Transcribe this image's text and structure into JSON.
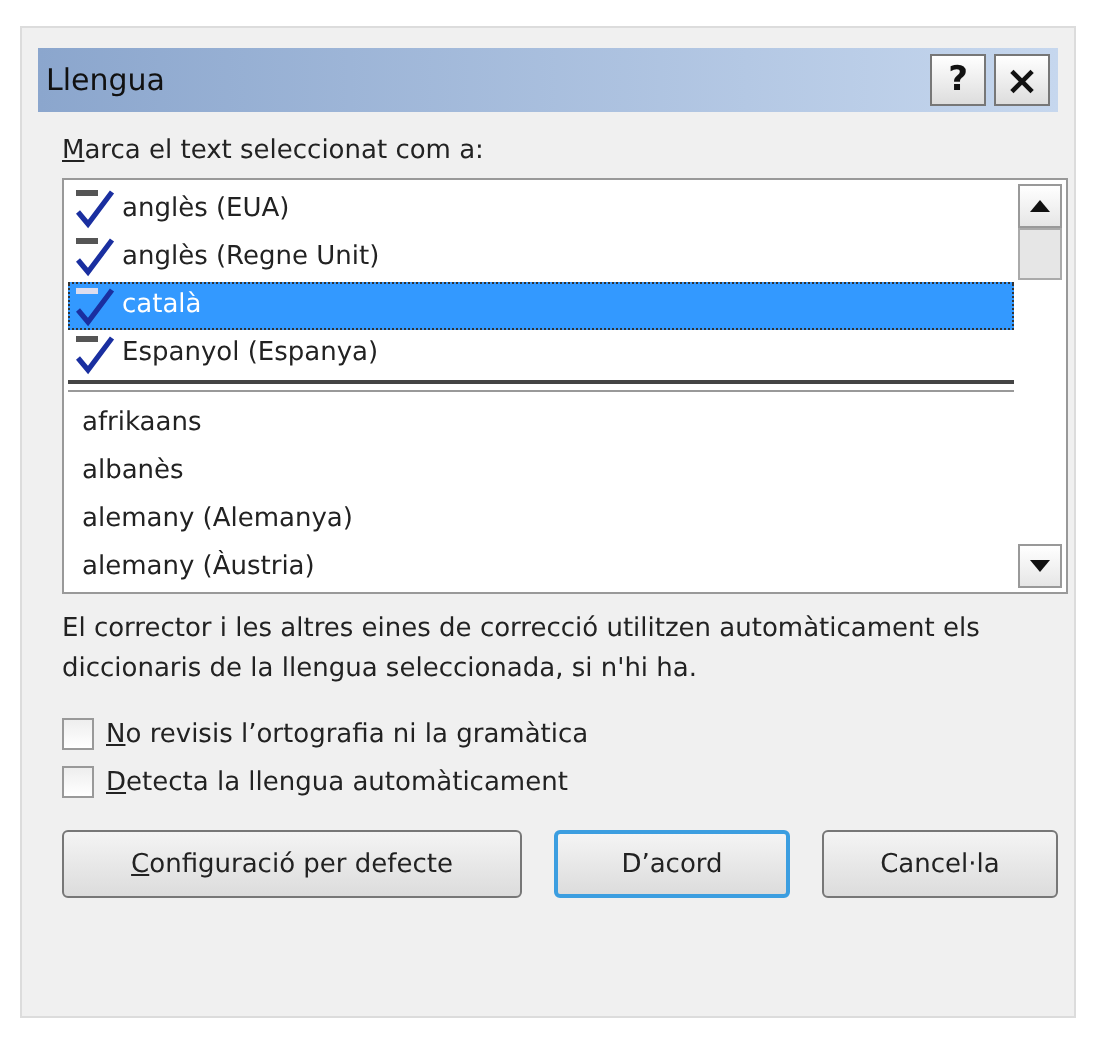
{
  "window": {
    "title": "Llengua",
    "buttons": [
      {
        "kind": "help",
        "label": "?"
      },
      {
        "kind": "close",
        "label": "×"
      }
    ]
  },
  "list_label": {
    "text": "Marca el text seleccionat com a:",
    "access_key": true
  },
  "languages": [
    {
      "name": "anglès (EUA)",
      "kind": "proofed",
      "selected": false
    },
    {
      "name": "anglès (Regne Unit)",
      "kind": "proofed",
      "selected": false
    },
    {
      "name": "català",
      "kind": "proofed",
      "selected": true
    },
    {
      "name": "Espanyol (Espanya)",
      "kind": "proofed",
      "selected": false
    },
    {
      "name": "afrikaans",
      "kind": "plain",
      "selected": false
    },
    {
      "name": "albanès",
      "kind": "plain",
      "selected": false
    },
    {
      "name": "alemany (Alemanya)",
      "kind": "plain",
      "selected": false
    },
    {
      "name": "alemany (Àustria)",
      "kind": "plain",
      "selected": false
    }
  ],
  "note": "El corrector i les altres eines de correcció utilitzen automàticament els diccionaris de la llengua seleccionada, si n'hi ha.",
  "options": [
    {
      "label": "No revisis l’ortografia ni la gramàtica",
      "checked": false,
      "access_key": true
    },
    {
      "label": "Detecta la llengua automàticament",
      "checked": false,
      "access_key": true
    }
  ],
  "buttons": [
    {
      "label": "Configuració per defecte",
      "default": false,
      "access_key": true
    },
    {
      "label": "D’acord",
      "default": true,
      "access_key": false
    },
    {
      "label": "Cancel·la",
      "default": false,
      "access_key": false
    }
  ]
}
